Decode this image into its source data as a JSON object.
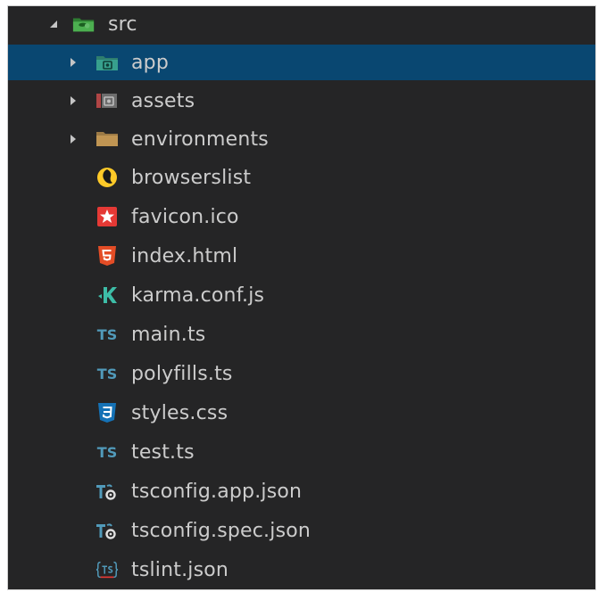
{
  "explorer": {
    "root": {
      "label": "src",
      "icon": "folder-src-icon",
      "expanded": true
    },
    "items": [
      {
        "label": "app",
        "type": "folder",
        "icon": "folder-app-icon",
        "selected": true
      },
      {
        "label": "assets",
        "type": "folder",
        "icon": "folder-assets-icon",
        "selected": false
      },
      {
        "label": "environments",
        "type": "folder",
        "icon": "folder-icon",
        "selected": false
      },
      {
        "label": "browserslist",
        "type": "file",
        "icon": "browserslist-icon",
        "selected": false
      },
      {
        "label": "favicon.ico",
        "type": "file",
        "icon": "favicon-star-icon",
        "selected": false
      },
      {
        "label": "index.html",
        "type": "file",
        "icon": "html5-icon",
        "selected": false
      },
      {
        "label": "karma.conf.js",
        "type": "file",
        "icon": "karma-icon",
        "selected": false
      },
      {
        "label": "main.ts",
        "type": "file",
        "icon": "typescript-icon",
        "selected": false
      },
      {
        "label": "polyfills.ts",
        "type": "file",
        "icon": "typescript-icon",
        "selected": false
      },
      {
        "label": "styles.css",
        "type": "file",
        "icon": "css3-icon",
        "selected": false
      },
      {
        "label": "test.ts",
        "type": "file",
        "icon": "typescript-icon",
        "selected": false
      },
      {
        "label": "tsconfig.app.json",
        "type": "file",
        "icon": "tsconfig-icon",
        "selected": false
      },
      {
        "label": "tsconfig.spec.json",
        "type": "file",
        "icon": "tsconfig-icon",
        "selected": false
      },
      {
        "label": "tslint.json",
        "type": "file",
        "icon": "tslint-icon",
        "selected": false
      }
    ],
    "icon_text": {
      "ts": "TS"
    },
    "colors": {
      "background": "#252526",
      "selection": "#094771",
      "text": "#cccccc",
      "typescript": "#519aba",
      "html": "#e44d26",
      "css": "#1572b6",
      "karma": "#3dbda7",
      "folder": "#c09553",
      "src_folder": "#4caf50"
    }
  }
}
